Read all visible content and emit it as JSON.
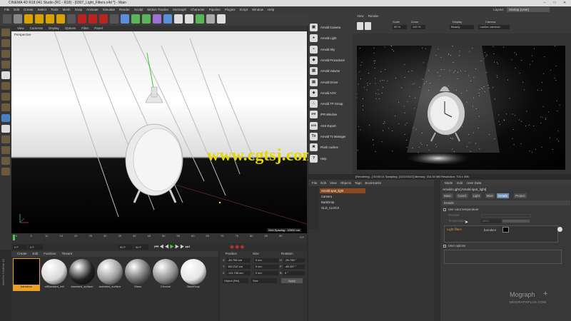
{
  "window": {
    "title": "CINEMA 4D R18.041 Studio (RC - R18) - [0307_Light_Filters.c4d *] - Main"
  },
  "menubar": [
    "File",
    "Edit",
    "Create",
    "Select",
    "Tools",
    "Mesh",
    "Snap",
    "Animate",
    "Simulate",
    "Render",
    "Sculpt",
    "Motion Tracker",
    "MoGraph",
    "Character",
    "Pipeline",
    "Plugins",
    "Script",
    "Window",
    "Help"
  ],
  "layout": {
    "label": "Layout:",
    "value": "Startup (User)"
  },
  "viewport": {
    "menu": [
      "View",
      "Cameras",
      "Display",
      "Options",
      "Filter",
      "Panel"
    ],
    "label": "Perspective",
    "grid_spacing": "Grid Spacing : 10000 cm"
  },
  "timeline": {
    "ticks": [
      "0",
      "5",
      "10",
      "15",
      "20",
      "25",
      "30",
      "35",
      "40",
      "45",
      "50",
      "55",
      "60",
      "65",
      "70",
      "75",
      "80",
      "85",
      "90"
    ],
    "end_frame": "0 F",
    "current_frame": "0 F",
    "min_frame": "0 F",
    "max_frame": "90 F",
    "max_frame_2": "90 F"
  },
  "materials": {
    "menu": [
      "Create",
      "Edit",
      "Function",
      "Texture"
    ],
    "items": [
      {
        "label": "barndoor",
        "color": "#111111",
        "selected": true
      },
      {
        "label": "alStandard_mtl",
        "color": "#d8d8d8"
      },
      {
        "label": "standard_surface",
        "color": "#222222"
      },
      {
        "label": "standard_surface",
        "color": "#9a9a9a"
      },
      {
        "label": "Glass",
        "color": "#6a6a6a"
      },
      {
        "label": "Chrome",
        "color": "#8a8a8a"
      },
      {
        "label": "BackDrop",
        "color": "#e4e4e4"
      }
    ]
  },
  "coordinates": {
    "headers": [
      "Position",
      "Size",
      "Rotation"
    ],
    "rows": [
      {
        "axis": "X",
        "pos": "-40.706 cm",
        "size": "0 cm",
        "rot_axis": "H",
        "rot": "-39.755 °"
      },
      {
        "axis": "Y",
        "pos": "162.212 cm",
        "size": "0 cm",
        "rot_axis": "P",
        "rot": "-49.157 °"
      },
      {
        "axis": "Z",
        "pos": "-111.745 cm",
        "size": "0 cm",
        "rot_axis": "B",
        "rot": "0 °"
      }
    ],
    "mode": "Object (Rel)",
    "size_mode": "Size",
    "apply": "Apply"
  },
  "arnold": {
    "items": [
      {
        "icon": "camera-icon",
        "label": "Arnold Camera",
        "glyph": "▣"
      },
      {
        "icon": "light-icon",
        "label": "Arnold Light",
        "glyph": "●"
      },
      {
        "icon": "sky-icon",
        "label": "Arnold Sky",
        "glyph": "◓"
      },
      {
        "icon": "procedural-icon",
        "label": "Arnold Procedural",
        "glyph": "◆"
      },
      {
        "icon": "volume-icon",
        "label": "Arnold Volume",
        "glyph": "▧"
      },
      {
        "icon": "driver-icon",
        "label": "Arnold Driver",
        "glyph": "▤"
      },
      {
        "icon": "aov-icon",
        "label": "Arnold AOV",
        "glyph": "◈"
      },
      {
        "icon": "tp-group-icon",
        "label": "Arnold TP Group",
        "glyph": "∴"
      },
      {
        "icon": "ipr-icon",
        "label": "IPR Window",
        "glyph": "IPR"
      },
      {
        "icon": "ass-export-icon",
        "label": "ASS Export",
        "glyph": "ASS"
      },
      {
        "icon": "tx-manager-icon",
        "label": "Arnold Tx Manager",
        "glyph": "Tx"
      },
      {
        "icon": "flush-caches-icon",
        "label": "Flush caches",
        "glyph": "✖"
      },
      {
        "icon": "help-icon",
        "label": "Help",
        "glyph": "?"
      }
    ]
  },
  "render_view": {
    "tabs": [
      "View",
      "Render"
    ],
    "scale_label": "Scale",
    "scale_value": "55 %",
    "zoom_label": "Zoom",
    "zoom_value": "100 %",
    "display_label": "Display",
    "display_value": "Beauty",
    "camera_label": "Camera",
    "camera_value": "<active camera>",
    "status": "[Rendering...] 00:00:01  Sampling: [1/2/2/2/2/2]  Memory: 314.30 MB  Resolution: 704 x 396"
  },
  "objects": {
    "menu": [
      "File",
      "Edit",
      "View",
      "Objects",
      "Tags",
      "Bookmarks"
    ],
    "rows": [
      {
        "name": "Arnold spot_light",
        "selected": true
      },
      {
        "name": "Camera",
        "selected": false
      },
      {
        "name": "BackDrop",
        "selected": false
      },
      {
        "name": "OLD_CLOCK",
        "selected": false
      }
    ]
  },
  "attributes": {
    "menu": [
      "Mode",
      "Edit",
      "User Data"
    ],
    "title": "Arnold Light [Arnold spot_light]",
    "tabs": [
      "Basic",
      "Coord.",
      "Light",
      "Main",
      "Details",
      "Project"
    ],
    "active_tab": "Details",
    "section": "Details",
    "use_color_temperature": "Use color temperature",
    "preview": "Preview",
    "temperature": "Temperature",
    "temperature_value": "6500",
    "light_filters_label": "Light filters",
    "light_filter_item": "barndoor",
    "user_options": "User options"
  },
  "branding": {
    "logo": "Mograph",
    "sub": "MOGRAPHPLUS.COM",
    "watermark": "www.cgtsj.com",
    "side": "MAXON CINEMA 4D"
  }
}
